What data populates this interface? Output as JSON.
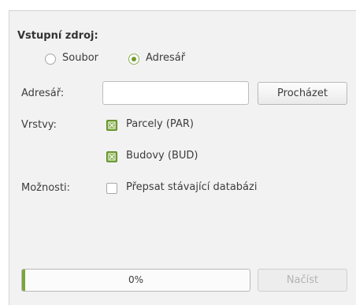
{
  "source": {
    "title": "Vstupní zdroj:",
    "options": [
      {
        "label": "Soubor",
        "selected": false
      },
      {
        "label": "Adresář",
        "selected": true
      }
    ]
  },
  "directory": {
    "label": "Adresář:",
    "value": "",
    "browse_label": "Procházet"
  },
  "layers": {
    "label": "Vrstvy:",
    "items": [
      {
        "label": "Parcely (PAR)",
        "checked": true
      },
      {
        "label": "Budovy (BUD)",
        "checked": true
      }
    ]
  },
  "options": {
    "label": "Možnosti:",
    "overwrite_label": "Přepsat stávající databázi",
    "overwrite_checked": false
  },
  "progress": {
    "value": 0,
    "text": "0%"
  },
  "load_button": {
    "label": "Načíst",
    "enabled": false
  },
  "colors": {
    "accent": "#7aa63a",
    "panel": "#f2f2f2"
  }
}
